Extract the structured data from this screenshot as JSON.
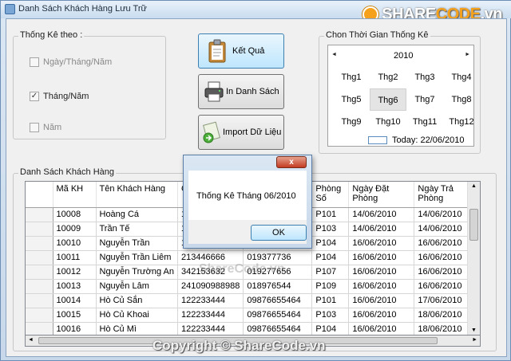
{
  "window": {
    "title": "Danh Sách Khách Hàng Lưu Trữ"
  },
  "logo": {
    "text_a": "SHARE",
    "text_b": "CODE",
    "text_c": ".vn"
  },
  "stats": {
    "group_label": "Thống Kê theo :",
    "options": [
      {
        "label": "Ngày/Tháng/Năm",
        "checked": false
      },
      {
        "label": "Tháng/Năm",
        "checked": true
      },
      {
        "label": "Năm",
        "checked": false
      }
    ]
  },
  "buttons": {
    "result": "Kết Quả",
    "print": "In Danh Sách",
    "import": "Import Dữ Liệu"
  },
  "calendar": {
    "group_label": "Chon Thời Gian Thống Kê",
    "year": "2010",
    "prev": "◄",
    "next": "►",
    "months": [
      "Thg1",
      "Thg2",
      "Thg3",
      "Thg4",
      "Thg5",
      "Thg6",
      "Thg7",
      "Thg8",
      "Thg9",
      "Thg10",
      "Thg11",
      "Thg12"
    ],
    "selected_index": 5,
    "today": "Today: 22/06/2010"
  },
  "customers": {
    "group_label": "Danh Sách Khách Hàng",
    "columns": [
      "Mã KH",
      "Tên Khách Hàng",
      "C",
      "",
      "Phòng Số",
      "Ngày Đặt Phòng",
      "Ngày Trả Phòng"
    ],
    "rows": [
      [
        "10008",
        "Hoàng Cá",
        "12",
        "",
        "P101",
        "14/06/2010",
        "14/06/2010"
      ],
      [
        "10009",
        "Trần Tế",
        "12",
        "",
        "P103",
        "14/06/2010",
        "14/06/2010"
      ],
      [
        "10010",
        "Nguyễn Trần",
        "12",
        "",
        "P104",
        "16/06/2010",
        "16/06/2010"
      ],
      [
        "10011",
        "Nguyễn Trần Liêm",
        "213446666",
        "019377736",
        "P104",
        "16/06/2010",
        "16/06/2010"
      ],
      [
        "10012",
        "Nguyễn Trường An",
        "342153632",
        "019277656",
        "P107",
        "16/06/2010",
        "16/06/2010"
      ],
      [
        "10013",
        "Nguyễn Lâm",
        "241090988988",
        "018976544",
        "P109",
        "16/06/2010",
        "16/06/2010"
      ],
      [
        "10014",
        "Hò Củ Sắn",
        "122233444",
        "09876655464",
        "P101",
        "16/06/2010",
        "17/06/2010"
      ],
      [
        "10015",
        "Hò Củ Khoai",
        "122233444",
        "09876655464",
        "P103",
        "16/06/2010",
        "18/06/2010"
      ],
      [
        "10016",
        "Hò Củ Mì",
        "122233444",
        "09876655464",
        "P104",
        "16/06/2010",
        "18/06/2010"
      ]
    ]
  },
  "dialog": {
    "message": "Thống Kê Tháng 06/2010",
    "ok": "OK",
    "close": "x"
  },
  "watermark": {
    "center": "ShareCode.vn",
    "bottom": "Copyright © ShareCode.vn"
  }
}
